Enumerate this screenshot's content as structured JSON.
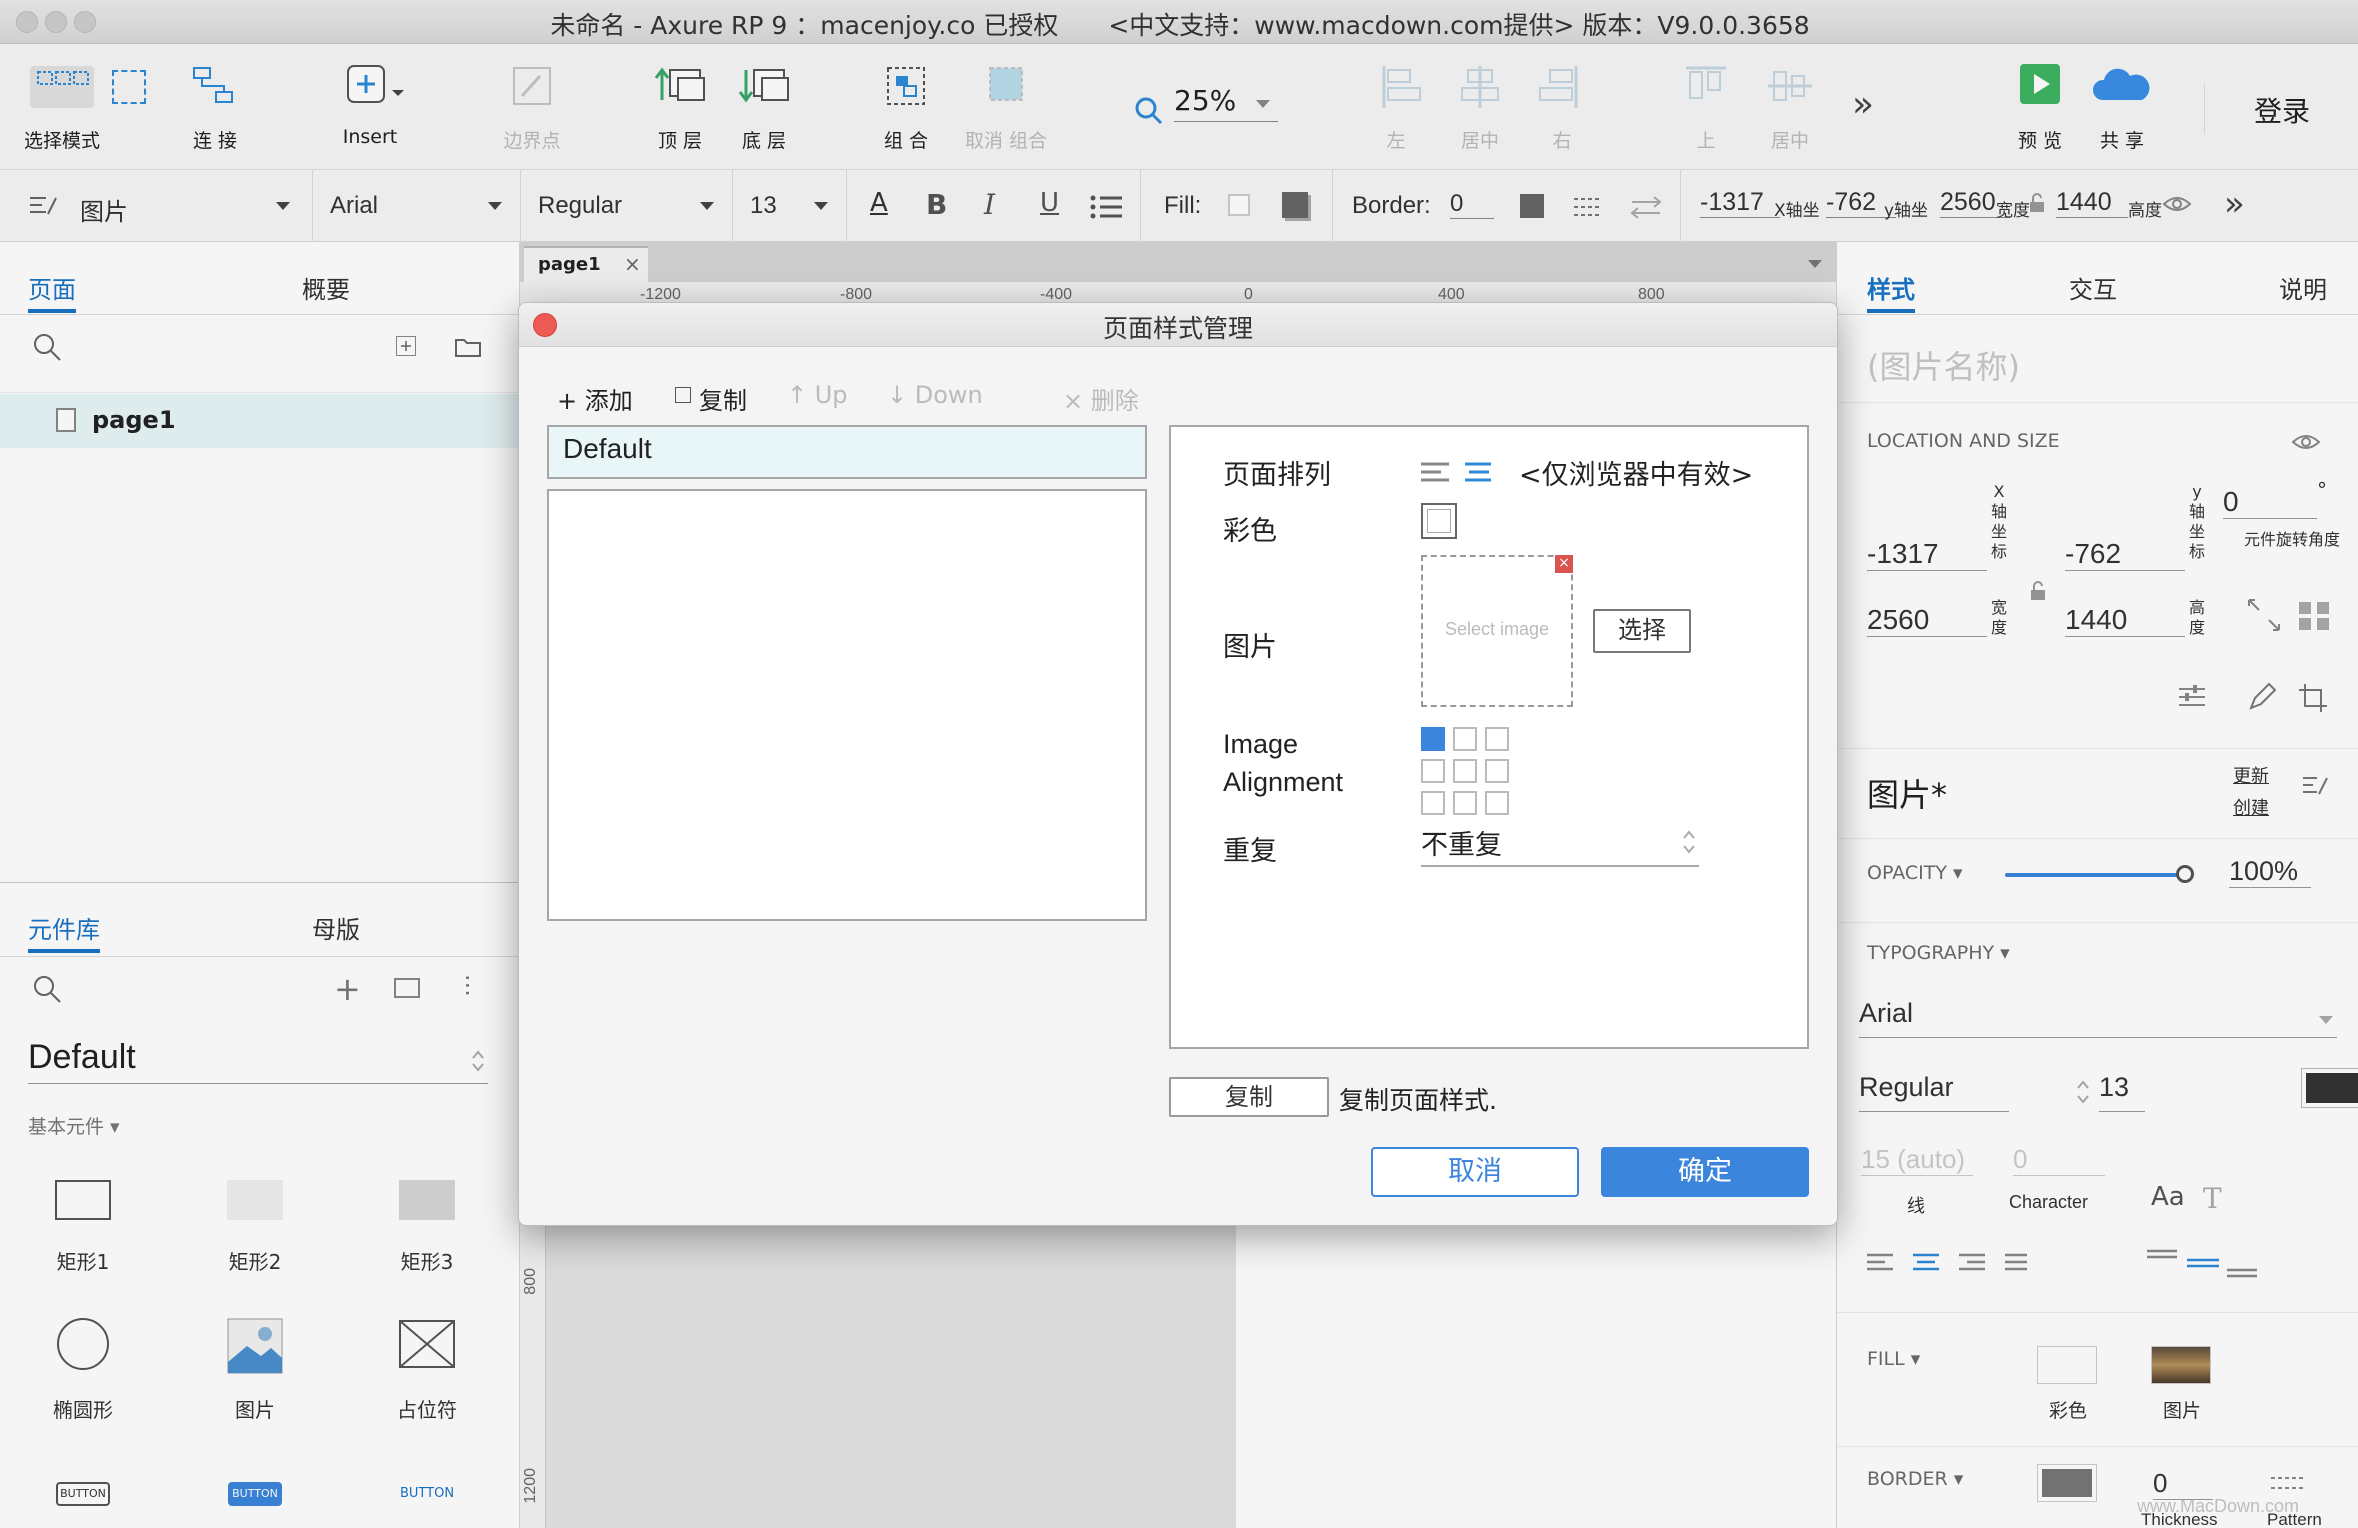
{
  "window": {
    "title": "未命名 - Axure RP 9 ：macenjoy.co 已授权　　<中文支持：www.macdown.com提供> 版本：V9.0.0.3658"
  },
  "toolbar": {
    "select_mode": "选择模式",
    "connect": "连 接",
    "insert": "Insert",
    "boundary": "边界点",
    "to_top": "顶 层",
    "to_bottom": "底 层",
    "group": "组 合",
    "ungroup": "取消 组合",
    "zoom": "25%",
    "align_left": "左",
    "align_center": "居中",
    "align_right": "右",
    "align_top": "上",
    "align_middle": "居中",
    "more": "»",
    "preview": "预 览",
    "share": "共 享",
    "login": "登录"
  },
  "format": {
    "style": "图片",
    "font": "Arial",
    "weight": "Regular",
    "size": "13",
    "fill_label": "Fill:",
    "border_label": "Border:",
    "border_value": "0",
    "x": "-1317",
    "x_label": "X轴坐",
    "y": "-762",
    "y_label": "y轴坐",
    "w": "2560",
    "w_label": "宽度",
    "h": "1440",
    "h_label": "高度",
    "more": "»"
  },
  "left": {
    "tabs": [
      "页面",
      "概要"
    ],
    "page": "page1",
    "lib_tabs": [
      "元件库",
      "母版"
    ],
    "library": "Default",
    "section": "基本元件 ▾",
    "items": [
      {
        "label": "矩形1"
      },
      {
        "label": "矩形2"
      },
      {
        "label": "矩形3"
      },
      {
        "label": "椭圆形"
      },
      {
        "label": "图片"
      },
      {
        "label": "占位符"
      },
      {
        "label": "BUTTON"
      },
      {
        "label": "BUTTON"
      },
      {
        "label": "BUTTON"
      }
    ]
  },
  "canvas": {
    "tab": "page1",
    "tab_close": "×",
    "ruler_h": [
      "-1200",
      "-800",
      "-400",
      "0",
      "400",
      "800"
    ],
    "ruler_v": [
      "800",
      "1200"
    ]
  },
  "right": {
    "tabs": [
      "样式",
      "交互",
      "说明"
    ],
    "name_placeholder": "(图片名称)",
    "loc_header": "LOCATION AND SIZE",
    "x": "-1317",
    "y": "-762",
    "w": "2560",
    "h": "1440",
    "rot": "0",
    "deg": "°",
    "x_label": "X轴坐标",
    "y_label": "y轴坐标",
    "w_label": "宽度",
    "h_label": "高度",
    "rot_label": "元件旋转角度",
    "style_name": "图片*",
    "update": "更新",
    "create": "创建",
    "opacity_header": "OPACITY ▾",
    "opacity": "100%",
    "opacity_fraction": 1.0,
    "typo_header": "TYPOGRAPHY ▾",
    "font": "Arial",
    "weight": "Regular",
    "size": "13",
    "line": "15 (auto)",
    "line_label": "线",
    "char": "0",
    "char_label": "Character",
    "fill_header": "FILL ▾",
    "fill_color": "彩色",
    "fill_image": "图片",
    "border_header": "BORDER ▾",
    "border_thickness": "0",
    "thickness_label": "Thickness",
    "pattern_label": "Pattern",
    "watermark": "www.MacDown.com"
  },
  "dialog": {
    "title": "页面样式管理",
    "add": "+ 添加",
    "copy": "复制",
    "up": "↑ Up",
    "down": "↓ Down",
    "delete": "× 删除",
    "styles": [
      "Default"
    ],
    "arrange_label": "页面排列",
    "arrange_note": "<仅浏览器中有效>",
    "color_label": "彩色",
    "image_label": "图片",
    "select_image": "Select image",
    "choose": "选择",
    "align_label_1": "Image",
    "align_label_2": "Alignment",
    "repeat_label": "重复",
    "repeat_value": "不重复",
    "copy_btn": "复制",
    "copy_desc": "复制页面样式.",
    "cancel": "取消",
    "ok": "确定"
  },
  "colors": {
    "accent": "#1a73c7",
    "primary": "#3b86dc",
    "close": "#ec5a53",
    "preview": "#3fb463",
    "share": "#3b8ee8"
  }
}
